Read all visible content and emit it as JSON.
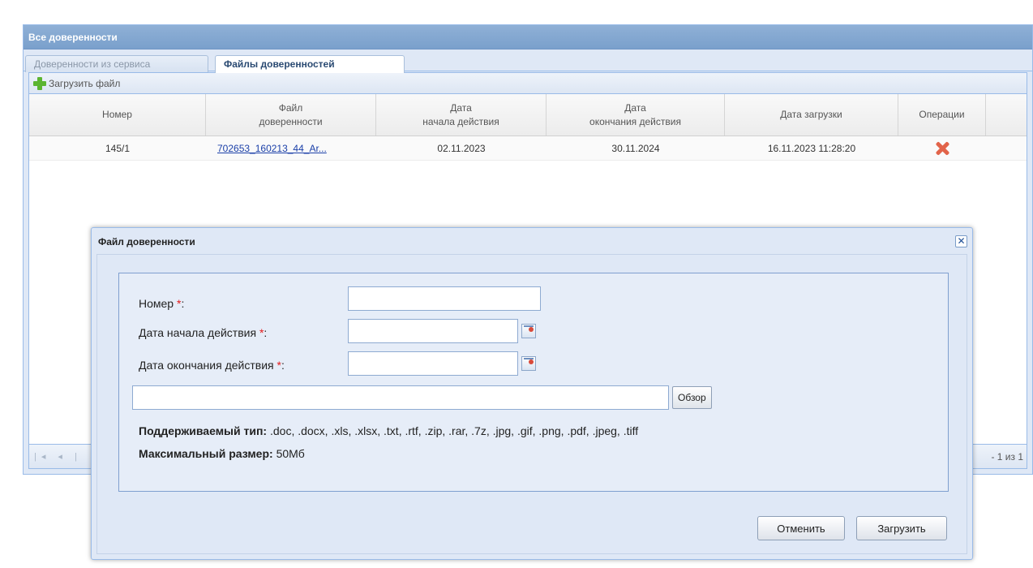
{
  "panel": {
    "title": "Все доверенности"
  },
  "tabs": [
    {
      "label": "Доверенности из сервиса",
      "active": false
    },
    {
      "label": "Файлы доверенностей",
      "active": true
    }
  ],
  "toolbar": {
    "upload_label": "Загрузить файл"
  },
  "grid": {
    "columns": [
      "Номер",
      "Файл\nдоверенности",
      "Дата\nначала действия",
      "Дата\nокончания действия",
      "Дата загрузки",
      "Операции"
    ],
    "rows": [
      {
        "number": "145/1",
        "file": "702653_160213_44_Ar...",
        "start": "02.11.2023",
        "end": "30.11.2024",
        "uploaded": "16.11.2023 11:28:20"
      }
    ]
  },
  "pager": {
    "info": "- 1 из 1"
  },
  "modal": {
    "title": "Файл доверенности",
    "close_label": "✕",
    "fields": {
      "number_label": "Номер ",
      "start_label": "Дата начала действия ",
      "end_label": "Дата окончания действия ",
      "required_mark": "*",
      "colon": ":",
      "number_value": "",
      "start_value": "",
      "end_value": "",
      "file_value": ""
    },
    "browse_label": "Обзор",
    "supported_label": "Поддерживаемый тип:",
    "supported_value": " .doc, .docx, .xls, .xlsx, .txt, .rtf, .zip, .rar, .7z, .jpg, .gif, .png, .pdf, .jpeg, .tiff",
    "max_size_label": "Максимальный размер:",
    "max_size_value": " 50Мб",
    "cancel_label": "Отменить",
    "upload_label": "Загрузить"
  },
  "colors": {
    "header_bg": "#7aa0cc",
    "panel_bg": "#dfe8f6",
    "link": "#1a3fa8",
    "required": "#e31b1b",
    "delete": "#e2644a",
    "add": "#5cb531"
  },
  "icons": [
    "add-icon",
    "delete-icon",
    "close-icon",
    "calendar-icon",
    "pager-first-icon"
  ]
}
